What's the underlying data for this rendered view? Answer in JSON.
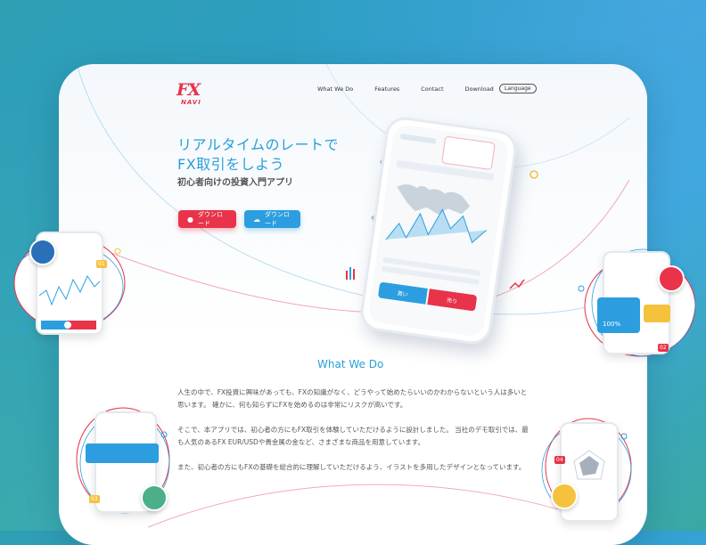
{
  "logo": {
    "fx": "FX",
    "navi": "NAVI"
  },
  "nav": {
    "items": [
      {
        "label": "What We Do"
      },
      {
        "label": "Features"
      },
      {
        "label": "Contact"
      },
      {
        "label": "Download"
      }
    ],
    "language_label": "Language"
  },
  "hero": {
    "title_line1": "リアルタイムのレートで",
    "title_line2": "FX取引をしよう",
    "subtitle": "初心者向けの投資入門アプリ",
    "btn_ios_label": "ダウンロード",
    "btn_android_label": "ダウンロード"
  },
  "phone": {
    "buy_label": "買い",
    "sell_label": "売り"
  },
  "section": {
    "title": "What We Do",
    "paragraphs": [
      "人生の中で、FX投資に興味があっても、FXの知識がなく、どうやって始めたらいいのかわからないという人は多いと思います。 確かに、何も知らずにFXを始めるのは非常にリスクが高いです。",
      "そこで、本アプリでは、初心者の方にもFX取引を体験していただけるように設計しました。 当社のデモ取引では、最も人気のあるFX EUR/USDや貴金属の金など、さまざまな商品を用意しています。",
      "また、初心者の方にもFXの基礎を総合的に理解していただけるよう、イラストを多用したデザインとなっています。"
    ]
  },
  "badges": {
    "b01": "01",
    "b02": "02",
    "b03": "03",
    "b04": "04"
  },
  "widget_percent": "100%",
  "colors": {
    "accent_blue": "#2a9fd8",
    "accent_red": "#e8334a",
    "gold": "#f5c23d"
  }
}
